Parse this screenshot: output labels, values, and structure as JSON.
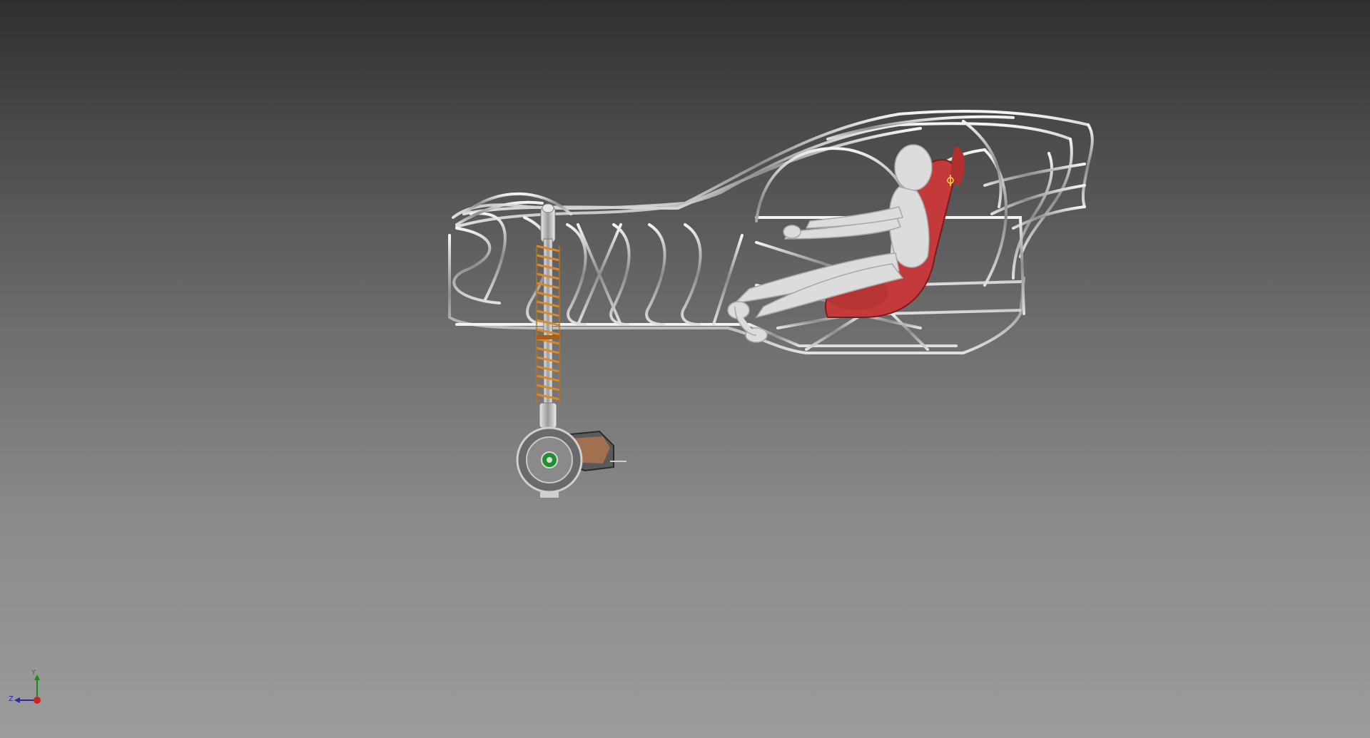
{
  "viewport": {
    "background_top": "#2f2f2f",
    "background_bottom": "#9c9c9c"
  },
  "model": {
    "frame_color": "#c9c9c9",
    "spring_color": "#d9892a",
    "seat_color": "#c43a3a",
    "mannequin_color": "#dcdcdc",
    "hub_center_color": "#1f8f2f"
  },
  "triad": {
    "z_label": "Z",
    "y_label": "Y",
    "z_color": "#2a2aa8",
    "y_color": "#1b8a1b",
    "x_color": "#cc2222"
  }
}
